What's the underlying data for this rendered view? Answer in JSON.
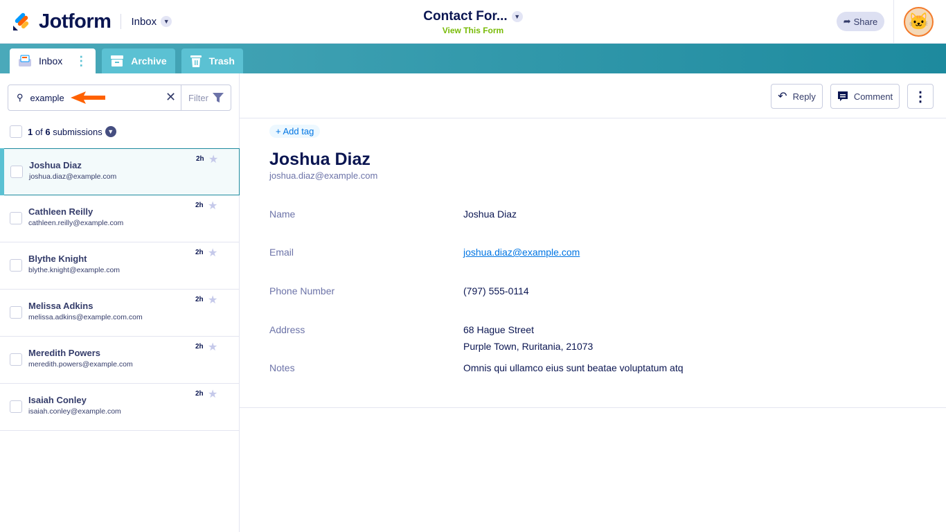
{
  "header": {
    "brand": "Jotform",
    "inbox_label": "Inbox",
    "form_title": "Contact For...",
    "view_form": "View This Form",
    "share": "Share"
  },
  "tabs": [
    {
      "label": "Inbox"
    },
    {
      "label": "Archive"
    },
    {
      "label": "Trash"
    }
  ],
  "search": {
    "value": "example",
    "filter": "Filter"
  },
  "count": {
    "current": "1",
    "of": "of",
    "total": "6",
    "suffix": "submissions"
  },
  "submissions": [
    {
      "name": "Joshua Diaz",
      "email": "joshua.diaz@example.com",
      "time": "2h"
    },
    {
      "name": "Cathleen Reilly",
      "email": "cathleen.reilly@example.com",
      "time": "2h"
    },
    {
      "name": "Blythe Knight",
      "email": "blythe.knight@example.com",
      "time": "2h"
    },
    {
      "name": "Melissa Adkins",
      "email": "melissa.adkins@example.com.com",
      "time": "2h"
    },
    {
      "name": "Meredith Powers",
      "email": "meredith.powers@example.com",
      "time": "2h"
    },
    {
      "name": "Isaiah Conley",
      "email": "isaiah.conley@example.com",
      "time": "2h"
    }
  ],
  "actions": {
    "reply": "Reply",
    "comment": "Comment"
  },
  "detail": {
    "add_tag": "+ Add tag",
    "name": "Joshua Diaz",
    "email": "joshua.diaz@example.com",
    "fields": {
      "name_label": "Name",
      "name_value": "Joshua Diaz",
      "email_label": "Email",
      "email_value": "joshua.diaz@example.com",
      "phone_label": "Phone Number",
      "phone_value": "(797) 555-0114",
      "address_label": "Address",
      "address_line1": "68 Hague Street",
      "address_line2": "Purple Town, Ruritania, 21073",
      "notes_label": "Notes",
      "notes_value": "Omnis qui ullamco eius sunt beatae voluptatum atq"
    }
  }
}
